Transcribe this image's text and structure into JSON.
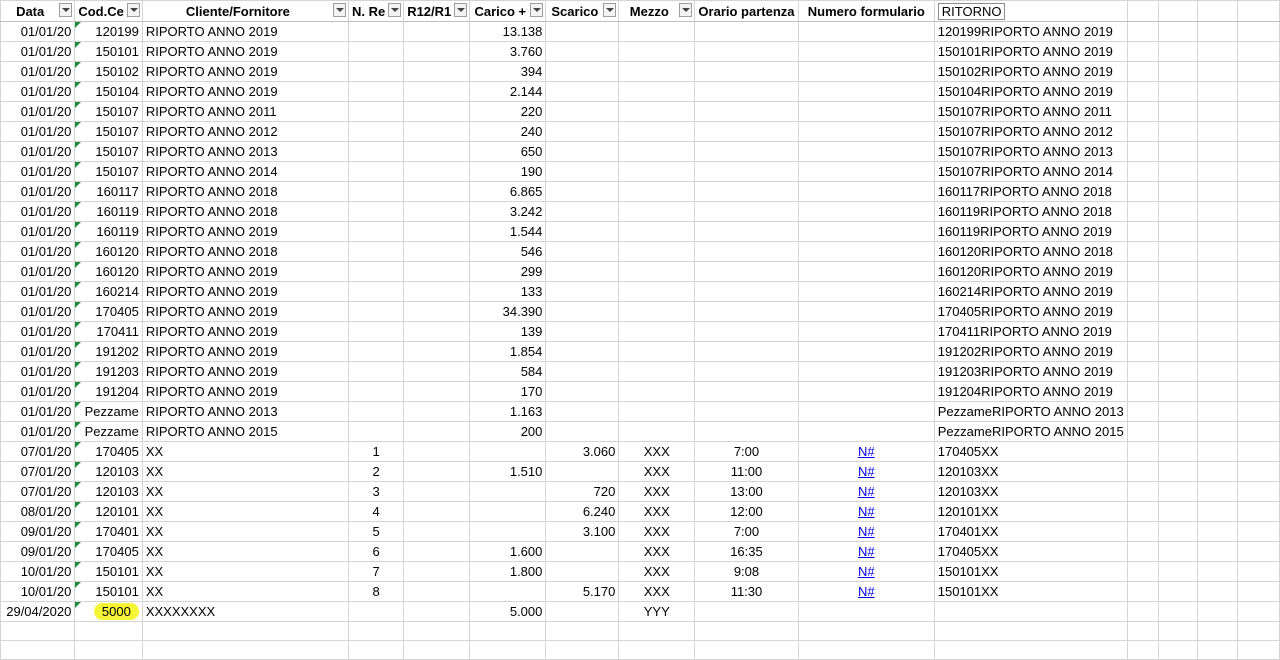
{
  "headers": [
    {
      "label": "Data",
      "filter": true
    },
    {
      "label": "Cod.Ce",
      "filter": true
    },
    {
      "label": "Cliente/Fornitore",
      "filter": true
    },
    {
      "label": "N. Re",
      "filter": true
    },
    {
      "label": "R12/R1",
      "filter": true
    },
    {
      "label": "Carico +",
      "filter": true
    },
    {
      "label": "Scarico",
      "filter": true
    },
    {
      "label": "Mezzo",
      "filter": true
    },
    {
      "label": "Orario partenza",
      "filter": false
    },
    {
      "label": "Numero formulario",
      "filter": false
    },
    {
      "label": "RITORNO",
      "filter": false,
      "boxed": true
    },
    {
      "label": "",
      "filter": false
    },
    {
      "label": "",
      "filter": false
    },
    {
      "label": "",
      "filter": false
    },
    {
      "label": "",
      "filter": false
    }
  ],
  "rows": [
    {
      "data": "01/01/20",
      "cod": "120199",
      "cliente": "RIPORTO ANNO 2019",
      "nreg": "",
      "r12": "",
      "carico": "13.138",
      "scarico": "",
      "mezzo": "",
      "orario": "",
      "formulario": "",
      "ritorno": "120199RIPORTO ANNO 2019"
    },
    {
      "data": "01/01/20",
      "cod": "150101",
      "cliente": "RIPORTO ANNO 2019",
      "nreg": "",
      "r12": "",
      "carico": "3.760",
      "scarico": "",
      "mezzo": "",
      "orario": "",
      "formulario": "",
      "ritorno": "150101RIPORTO ANNO 2019"
    },
    {
      "data": "01/01/20",
      "cod": "150102",
      "cliente": "RIPORTO ANNO 2019",
      "nreg": "",
      "r12": "",
      "carico": "394",
      "scarico": "",
      "mezzo": "",
      "orario": "",
      "formulario": "",
      "ritorno": "150102RIPORTO ANNO 2019"
    },
    {
      "data": "01/01/20",
      "cod": "150104",
      "cliente": "RIPORTO ANNO 2019",
      "nreg": "",
      "r12": "",
      "carico": "2.144",
      "scarico": "",
      "mezzo": "",
      "orario": "",
      "formulario": "",
      "ritorno": "150104RIPORTO ANNO 2019"
    },
    {
      "data": "01/01/20",
      "cod": "150107",
      "cliente": "RIPORTO ANNO 2011",
      "nreg": "",
      "r12": "",
      "carico": "220",
      "scarico": "",
      "mezzo": "",
      "orario": "",
      "formulario": "",
      "ritorno": "150107RIPORTO ANNO 2011"
    },
    {
      "data": "01/01/20",
      "cod": "150107",
      "cliente": "RIPORTO ANNO 2012",
      "nreg": "",
      "r12": "",
      "carico": "240",
      "scarico": "",
      "mezzo": "",
      "orario": "",
      "formulario": "",
      "ritorno": "150107RIPORTO ANNO 2012"
    },
    {
      "data": "01/01/20",
      "cod": "150107",
      "cliente": "RIPORTO ANNO 2013",
      "nreg": "",
      "r12": "",
      "carico": "650",
      "scarico": "",
      "mezzo": "",
      "orario": "",
      "formulario": "",
      "ritorno": "150107RIPORTO ANNO 2013"
    },
    {
      "data": "01/01/20",
      "cod": "150107",
      "cliente": "RIPORTO ANNO 2014",
      "nreg": "",
      "r12": "",
      "carico": "190",
      "scarico": "",
      "mezzo": "",
      "orario": "",
      "formulario": "",
      "ritorno": "150107RIPORTO ANNO 2014"
    },
    {
      "data": "01/01/20",
      "cod": "160117",
      "cliente": "RIPORTO ANNO 2018",
      "nreg": "",
      "r12": "",
      "carico": "6.865",
      "scarico": "",
      "mezzo": "",
      "orario": "",
      "formulario": "",
      "ritorno": "160117RIPORTO ANNO 2018"
    },
    {
      "data": "01/01/20",
      "cod": "160119",
      "cliente": "RIPORTO ANNO 2018",
      "nreg": "",
      "r12": "",
      "carico": "3.242",
      "scarico": "",
      "mezzo": "",
      "orario": "",
      "formulario": "",
      "ritorno": "160119RIPORTO ANNO 2018"
    },
    {
      "data": "01/01/20",
      "cod": "160119",
      "cliente": "RIPORTO ANNO 2019",
      "nreg": "",
      "r12": "",
      "carico": "1.544",
      "scarico": "",
      "mezzo": "",
      "orario": "",
      "formulario": "",
      "ritorno": "160119RIPORTO ANNO 2019"
    },
    {
      "data": "01/01/20",
      "cod": "160120",
      "cliente": "RIPORTO ANNO 2018",
      "nreg": "",
      "r12": "",
      "carico": "546",
      "scarico": "",
      "mezzo": "",
      "orario": "",
      "formulario": "",
      "ritorno": "160120RIPORTO ANNO 2018"
    },
    {
      "data": "01/01/20",
      "cod": "160120",
      "cliente": "RIPORTO ANNO 2019",
      "nreg": "",
      "r12": "",
      "carico": "299",
      "scarico": "",
      "mezzo": "",
      "orario": "",
      "formulario": "",
      "ritorno": "160120RIPORTO ANNO 2019"
    },
    {
      "data": "01/01/20",
      "cod": "160214",
      "cliente": "RIPORTO ANNO 2019",
      "nreg": "",
      "r12": "",
      "carico": "133",
      "scarico": "",
      "mezzo": "",
      "orario": "",
      "formulario": "",
      "ritorno": "160214RIPORTO ANNO 2019"
    },
    {
      "data": "01/01/20",
      "cod": "170405",
      "cliente": "RIPORTO ANNO 2019",
      "nreg": "",
      "r12": "",
      "carico": "34.390",
      "scarico": "",
      "mezzo": "",
      "orario": "",
      "formulario": "",
      "ritorno": "170405RIPORTO ANNO 2019"
    },
    {
      "data": "01/01/20",
      "cod": "170411",
      "cliente": "RIPORTO ANNO 2019",
      "nreg": "",
      "r12": "",
      "carico": "139",
      "scarico": "",
      "mezzo": "",
      "orario": "",
      "formulario": "",
      "ritorno": "170411RIPORTO ANNO 2019"
    },
    {
      "data": "01/01/20",
      "cod": "191202",
      "cliente": "RIPORTO ANNO 2019",
      "nreg": "",
      "r12": "",
      "carico": "1.854",
      "scarico": "",
      "mezzo": "",
      "orario": "",
      "formulario": "",
      "ritorno": "191202RIPORTO ANNO 2019"
    },
    {
      "data": "01/01/20",
      "cod": "191203",
      "cliente": "RIPORTO ANNO 2019",
      "nreg": "",
      "r12": "",
      "carico": "584",
      "scarico": "",
      "mezzo": "",
      "orario": "",
      "formulario": "",
      "ritorno": "191203RIPORTO ANNO 2019"
    },
    {
      "data": "01/01/20",
      "cod": "191204",
      "cliente": "RIPORTO ANNO 2019",
      "nreg": "",
      "r12": "",
      "carico": "170",
      "scarico": "",
      "mezzo": "",
      "orario": "",
      "formulario": "",
      "ritorno": "191204RIPORTO ANNO 2019"
    },
    {
      "data": "01/01/20",
      "cod": "Pezzame",
      "cliente": "RIPORTO ANNO 2013",
      "nreg": "",
      "r12": "",
      "carico": "1.163",
      "scarico": "",
      "mezzo": "",
      "orario": "",
      "formulario": "",
      "ritorno": "PezzameRIPORTO ANNO 2013"
    },
    {
      "data": "01/01/20",
      "cod": "Pezzame",
      "cliente": "RIPORTO ANNO 2015",
      "nreg": "",
      "r12": "",
      "carico": "200",
      "scarico": "",
      "mezzo": "",
      "orario": "",
      "formulario": "",
      "ritorno": "PezzameRIPORTO ANNO 2015"
    },
    {
      "data": "07/01/20",
      "cod": "170405",
      "cliente": "XX",
      "nreg": "1",
      "r12": "",
      "carico": "",
      "scarico": "3.060",
      "mezzo": "XXX",
      "orario": "7:00",
      "formulario": "N#",
      "ritorno": "170405XX"
    },
    {
      "data": "07/01/20",
      "cod": "120103",
      "cliente": "XX",
      "nreg": "2",
      "r12": "",
      "carico": "1.510",
      "scarico": "",
      "mezzo": "XXX",
      "orario": "11:00",
      "formulario": "N#",
      "ritorno": "120103XX"
    },
    {
      "data": "07/01/20",
      "cod": "120103",
      "cliente": "XX",
      "nreg": "3",
      "r12": "",
      "carico": "",
      "scarico": "720",
      "mezzo": "XXX",
      "orario": "13:00",
      "formulario": "N#",
      "ritorno": "120103XX"
    },
    {
      "data": "08/01/20",
      "cod": "120101",
      "cliente": "XX",
      "nreg": "4",
      "r12": "",
      "carico": "",
      "scarico": "6.240",
      "mezzo": "XXX",
      "orario": "12:00",
      "formulario": "N#",
      "ritorno": "120101XX"
    },
    {
      "data": "09/01/20",
      "cod": "170401",
      "cliente": "XX",
      "nreg": "5",
      "r12": "",
      "carico": "",
      "scarico": "3.100",
      "mezzo": "XXX",
      "orario": "7:00",
      "formulario": "N#",
      "ritorno": "170401XX"
    },
    {
      "data": "09/01/20",
      "cod": "170405",
      "cliente": "XX",
      "nreg": "6",
      "r12": "",
      "carico": "1.600",
      "scarico": "",
      "mezzo": "XXX",
      "orario": "16:35",
      "formulario": "N#",
      "ritorno": "170405XX"
    },
    {
      "data": "10/01/20",
      "cod": "150101",
      "cliente": "XX",
      "nreg": "7",
      "r12": "",
      "carico": "1.800",
      "scarico": "",
      "mezzo": "XXX",
      "orario": "9:08",
      "formulario": "N#",
      "ritorno": "150101XX"
    },
    {
      "data": "10/01/20",
      "cod": "150101",
      "cliente": "XX",
      "nreg": "8",
      "r12": "",
      "carico": "",
      "scarico": "5.170",
      "mezzo": "XXX",
      "orario": "11:30",
      "formulario": "N#",
      "ritorno": "150101XX"
    },
    {
      "data": "29/04/2020",
      "cod": "5000",
      "cliente": "XXXXXXXX",
      "nreg": "",
      "r12": "",
      "carico": "5.000",
      "scarico": "",
      "mezzo": "YYY",
      "orario": "",
      "formulario": "",
      "ritorno": "",
      "highlight": true
    }
  ],
  "colors": {
    "highlight": "#f5f538",
    "corner_marker": "#1e8c3c",
    "link": "#0000ee",
    "gridline": "#d4d4d4"
  }
}
